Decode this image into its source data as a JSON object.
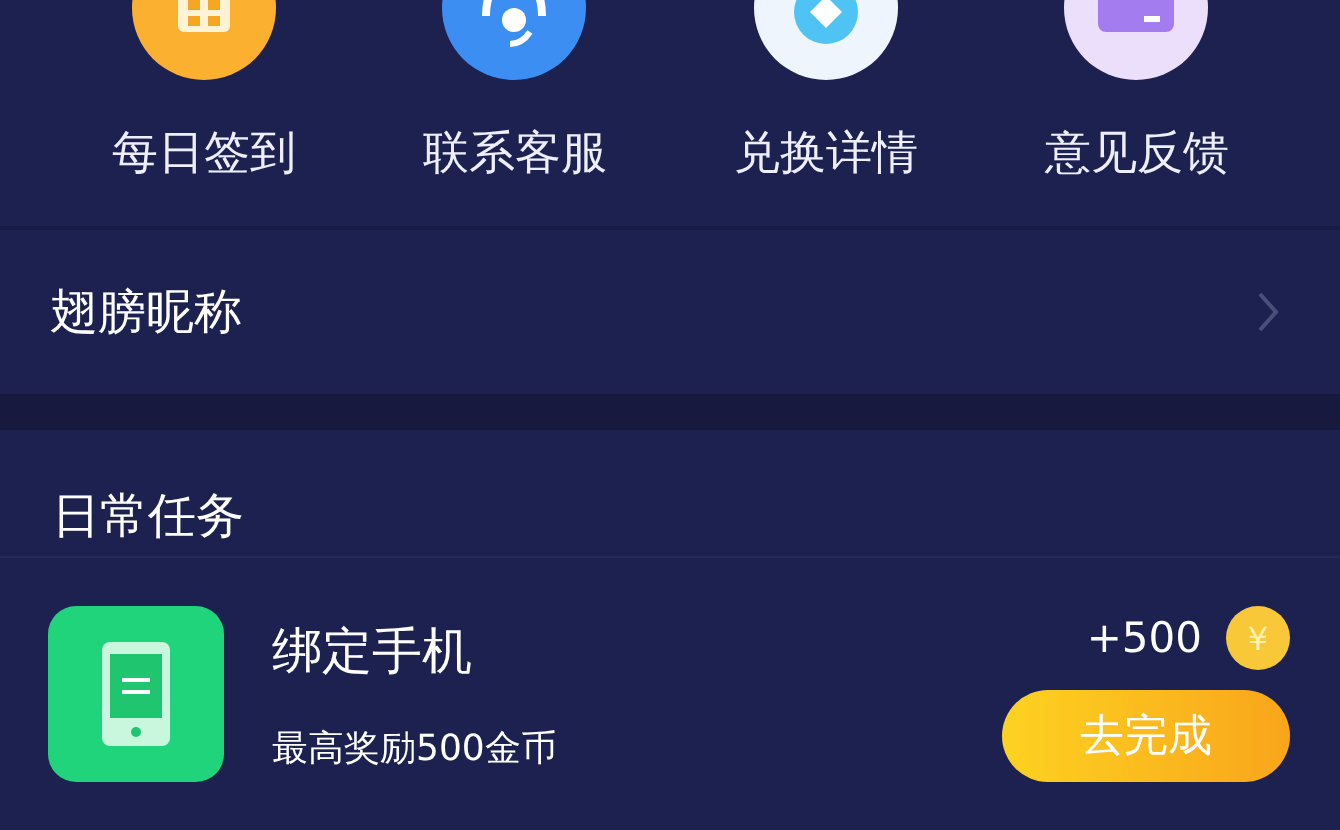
{
  "shortcuts": [
    {
      "kind": "calendar",
      "label": "每日签到"
    },
    {
      "kind": "service",
      "label": "联系客服"
    },
    {
      "kind": "exchange",
      "label": "兑换详情"
    },
    {
      "kind": "feedback",
      "label": "意见反馈"
    }
  ],
  "nickname_row": {
    "label": "翅膀昵称"
  },
  "section_title": "日常任务",
  "tasks": [
    {
      "title": "绑定手机",
      "subtitle": "最高奖励500金币",
      "reward": "+500",
      "coin": "¥",
      "button": "去完成"
    }
  ]
}
